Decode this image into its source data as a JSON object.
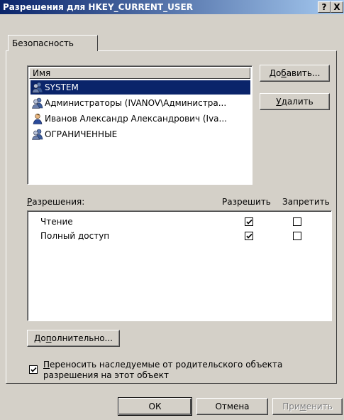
{
  "window": {
    "title": "Разрешения для HKEY_CURRENT_USER",
    "help_btn": "?",
    "close_btn": "X"
  },
  "tabs": [
    {
      "label": "Безопасность"
    }
  ],
  "users_list": {
    "column_header": "Имя",
    "items": [
      {
        "name": "SYSTEM",
        "selected": true,
        "icon": "group-icon"
      },
      {
        "name": "Администраторы (IVANOV\\Администра...",
        "selected": false,
        "icon": "group-icon"
      },
      {
        "name": "Иванов Александр Александрович (Iva...",
        "selected": false,
        "icon": "user-icon"
      },
      {
        "name": "ОГРАНИЧЕННЫЕ",
        "selected": false,
        "icon": "group-icon"
      }
    ]
  },
  "buttons": {
    "add": {
      "pre": "До",
      "u": "б",
      "post": "авить..."
    },
    "remove": {
      "pre": "",
      "u": "У",
      "post": "далить"
    },
    "advanced": {
      "pre": "До",
      "u": "п",
      "post": "олнительно..."
    },
    "ok": "ОК",
    "cancel": "Отмена",
    "apply": {
      "pre": "При",
      "u": "м",
      "post": "енить"
    }
  },
  "permissions": {
    "label": {
      "u": "Р",
      "rest": "азрешения:"
    },
    "allow_header": "Разрешить",
    "deny_header": "Запретить",
    "rows": [
      {
        "name": "Чтение",
        "allow": true,
        "deny": false
      },
      {
        "name": "Полный доступ",
        "allow": true,
        "deny": false
      }
    ]
  },
  "inherit": {
    "checked": true,
    "line1_u": "П",
    "line1_rest": "ереносить наследуемые от родительского объекта",
    "line2": "разрешения на этот объект"
  },
  "colors": {
    "titlebar_start": "#0a246a",
    "titlebar_end": "#a6caf0",
    "selection": "#0a246a",
    "dialog_bg": "#d4d0c8"
  }
}
